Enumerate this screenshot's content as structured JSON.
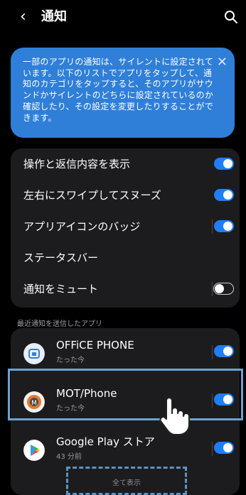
{
  "header": {
    "title": "通知"
  },
  "banner": {
    "text": "一部のアプリの通知は、サイレントに設定されています。以下のリストでアプリをタップして、通知のカテゴリをタップすると、そのアプリがサウンドかサイレントのどちらに設定されているのか確認したり、その設定を変更したりすることができます。"
  },
  "settings": [
    {
      "label": "操作と返信内容を表示",
      "enabled": true
    },
    {
      "label": "左右にスワイプしてスヌーズ",
      "enabled": true
    },
    {
      "label": "アプリアイコンのバッジ",
      "enabled": true
    },
    {
      "label": "ステータスバー"
    },
    {
      "label": "通知をミュート",
      "enabled": false
    }
  ],
  "recent_section": {
    "label": "最近通知を送信したアプリ"
  },
  "apps": [
    {
      "name": "OFFiCE PHONE",
      "time": "たった今",
      "enabled": true
    },
    {
      "name": "MOT/Phone",
      "time": "たった今",
      "enabled": true
    },
    {
      "name": "Google Play ストア",
      "time": "43 分前",
      "enabled": true
    }
  ],
  "show_all": {
    "label": "全て表示"
  },
  "colors": {
    "accent": "#1f7ef5",
    "banner": "#2f7fd8",
    "highlight": "#6aa3d4"
  }
}
